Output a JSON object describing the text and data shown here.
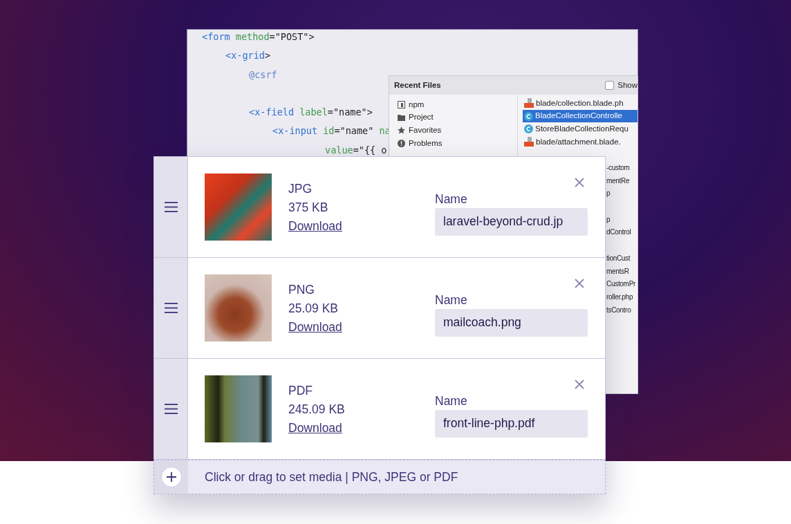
{
  "editor": {
    "code": [
      {
        "kind": "line",
        "parts": [
          {
            "kind": "tag",
            "text": "<form"
          },
          {
            "kind": "attr",
            "text": " method"
          },
          {
            "kind": "plain",
            "text": "=\"POST\">"
          }
        ],
        "children": [
          {
            "kind": "line",
            "parts": [
              {
                "kind": "tag",
                "text": "<x-grid"
              },
              {
                "kind": "plain",
                "text": ">"
              }
            ],
            "children": [
              {
                "kind": "line",
                "parts": [
                  {
                    "kind": "directive",
                    "text": "@csrf"
                  }
                ]
              },
              {
                "kind": "blank"
              },
              {
                "kind": "line",
                "parts": [
                  {
                    "kind": "tag",
                    "text": "<x-field"
                  },
                  {
                    "kind": "attr",
                    "text": " label"
                  },
                  {
                    "kind": "plain",
                    "text": "=\"name\">"
                  }
                ],
                "children": [
                  {
                    "kind": "line",
                    "parts": [
                      {
                        "kind": "tag",
                        "text": "<x-input"
                      },
                      {
                        "kind": "attr",
                        "text": " id"
                      },
                      {
                        "kind": "plain",
                        "text": "=\"name\" "
                      },
                      {
                        "kind": "attr",
                        "text": "na"
                      }
                    ],
                    "children": [
                      {
                        "kind": "line",
                        "parts": [
                          {
                            "kind": "attr",
                            "text": "value"
                          },
                          {
                            "kind": "plain",
                            "text": "=\"{{ o"
                          }
                        ]
                      }
                    ]
                  }
                ]
              }
            ]
          }
        ]
      }
    ]
  },
  "recent_files": {
    "title": "Recent Files",
    "show_checkbox": {
      "label": "Show",
      "checked": false
    },
    "tool_windows": [
      {
        "label": "npm",
        "kind": "npm"
      },
      {
        "label": "Project",
        "kind": "folder"
      },
      {
        "label": "Favorites",
        "kind": "star"
      },
      {
        "label": "Problems",
        "kind": "alert"
      }
    ],
    "files": [
      {
        "label": "blade/collection.blade.ph",
        "kind": "blade",
        "selected": false
      },
      {
        "label": "BladeCollectionControlle",
        "kind": "class",
        "selected": true
      },
      {
        "label": "StoreBladeCollectionRequ",
        "kind": "class",
        "selected": false
      },
      {
        "label": "blade/attachment.blade.",
        "kind": "blade",
        "selected": false
      }
    ],
    "file_fragments": [
      {
        "kind": "text",
        "text": "-custom"
      },
      {
        "kind": "text",
        "text": "mentRe"
      },
      {
        "kind": "text",
        "text": "p"
      },
      {
        "kind": "blank"
      },
      {
        "kind": "text",
        "text": "p"
      },
      {
        "kind": "text",
        "text": "dControl"
      },
      {
        "kind": "blank"
      },
      {
        "kind": "text",
        "text": "tionCust"
      },
      {
        "kind": "text",
        "text": "mentsR"
      },
      {
        "kind": "text",
        "text": "CustomPr"
      },
      {
        "kind": "text",
        "text": "roller.php"
      },
      {
        "kind": "text",
        "text": "tsContro"
      }
    ]
  },
  "media_list": {
    "items": [
      {
        "type": "JPG",
        "size": "375 KB",
        "download": "Download",
        "name_label": "Name",
        "name": "laravel-beyond-crud.jp"
      },
      {
        "type": "PNG",
        "size": "25.09 KB",
        "download": "Download",
        "name_label": "Name",
        "name": "mailcoach.png"
      },
      {
        "type": "PDF",
        "size": "245.09 KB",
        "download": "Download",
        "name_label": "Name",
        "name": "front-line-php.pdf"
      }
    ],
    "dropzone": "Click or drag to set media | PNG, JPEG or PDF"
  }
}
